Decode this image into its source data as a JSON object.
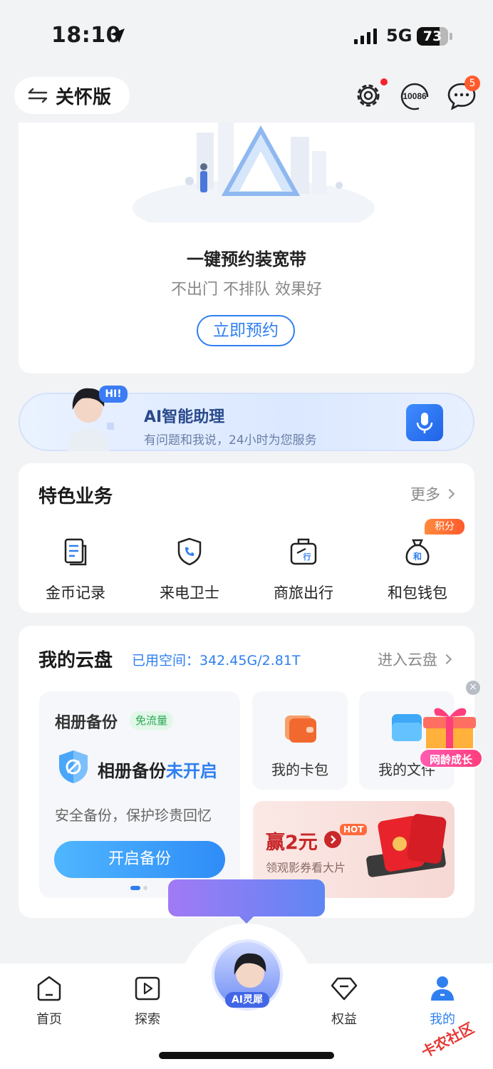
{
  "status_bar": {
    "time": "18:10",
    "network": "5G",
    "battery": "73",
    "battery_level": 0.73
  },
  "header": {
    "care_mode_label": "关怀版",
    "service_hotline": "10086",
    "message_badge": "5"
  },
  "broadband": {
    "title": "一键预约装宽带",
    "subtitle": "不出门 不排队 效果好",
    "button": "立即预约"
  },
  "ai_assistant": {
    "bubble": "HI!",
    "title": "AI智能助理",
    "subtitle": "有问题和我说，24小时为您服务"
  },
  "features": {
    "title": "特色业务",
    "more": "更多",
    "items": [
      {
        "label": "金币记录",
        "icon": "document-icon"
      },
      {
        "label": "来电卫士",
        "icon": "phone-shield-icon"
      },
      {
        "label": "商旅出行",
        "icon": "luggage-icon"
      },
      {
        "label": "和包钱包",
        "icon": "money-bag-icon",
        "tag": "积分"
      }
    ]
  },
  "cloud": {
    "title": "我的云盘",
    "used_space": "已用空间：342.45G/2.81T",
    "enter": "进入云盘",
    "backup": {
      "title": "相册备份",
      "free_tag": "免流量",
      "status_prefix": "相册备份",
      "status_value": "未开启",
      "desc": "安全备份，保护珍贵回忆",
      "button": "开启备份"
    },
    "tiles": [
      {
        "label": "我的卡包",
        "icon": "wallet-icon"
      },
      {
        "label": "我的文件",
        "icon": "folder-icon"
      }
    ],
    "promo": {
      "title": "赢2元",
      "hot": "HOT",
      "subtitle": "领观影券看大片"
    },
    "gift": {
      "label": "网龄成长",
      "close": "×"
    }
  },
  "tabbar": {
    "items": [
      {
        "label": "首页"
      },
      {
        "label": "探索"
      },
      {
        "label": "AI灵犀"
      },
      {
        "label": "权益"
      },
      {
        "label": "我的"
      }
    ]
  },
  "watermark": "卡农社区",
  "colors": {
    "accent": "#2f7ff0",
    "badge": "#ff5a2c",
    "promo_red": "#c9282a"
  }
}
